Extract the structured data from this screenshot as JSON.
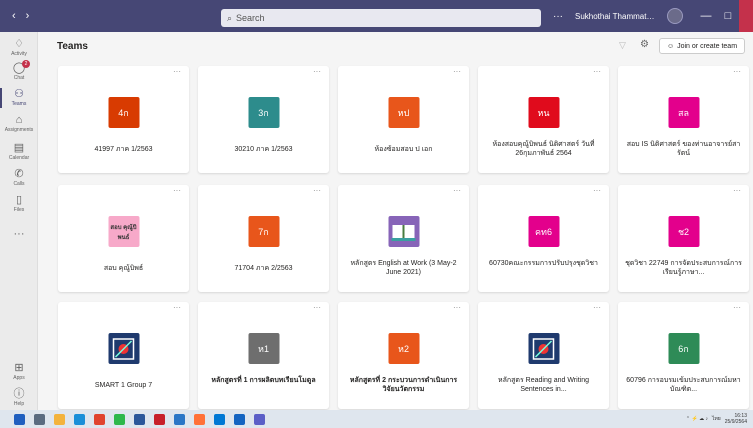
{
  "titlebar": {
    "back_icon": "chevron-left-icon",
    "forward_icon": "chevron-right-icon",
    "search_placeholder": "Search",
    "more_label": "···",
    "user_name": "Sukhothai Thammathirat Open ...",
    "minimize": "—",
    "maximize": "□"
  },
  "rail": {
    "items": [
      {
        "label": "Activity",
        "icon": "bell-icon"
      },
      {
        "label": "Chat",
        "icon": "chat-icon",
        "badge": "2"
      },
      {
        "label": "Teams",
        "icon": "teams-icon",
        "active": true
      },
      {
        "label": "Assignments",
        "icon": "assignments-icon"
      },
      {
        "label": "Calendar",
        "icon": "calendar-icon"
      },
      {
        "label": "Calls",
        "icon": "phone-icon"
      },
      {
        "label": "Files",
        "icon": "file-icon"
      },
      {
        "label": "···",
        "icon": "more-icon"
      },
      {
        "label": "Apps",
        "icon": "apps-icon"
      },
      {
        "label": "Help",
        "icon": "help-icon"
      }
    ]
  },
  "header": {
    "title": "Teams",
    "join_label": "Join or create team"
  },
  "teams": [
    {
      "tile": "4ก",
      "color": "#d83b01",
      "name": "41997 ภาค 1/2563"
    },
    {
      "tile": "3ก",
      "color": "#2d8c8c",
      "name": "30210 ภาค 1/2563"
    },
    {
      "tile": "หป",
      "color": "#e8561b",
      "name": "ห้องซ้อมสอบ ป เอก"
    },
    {
      "tile": "หน",
      "color": "#e00b1c",
      "name": "ห้องสอบคุณู้บิพนธ์ นิติศาสตร์ วันที่ 26กุมภาพันธ์ 2564"
    },
    {
      "tile": "สล",
      "color": "#e3008c",
      "name": "สอบ IS นิติศาสตร์ ของท่านอาจารย์สารัตน์"
    },
    {
      "tile": "สอบ คุณู้บิพนธ์",
      "color": "#f7a9c9",
      "text_color": "#333333",
      "name": "สอบ คุณู้บิพธ์"
    },
    {
      "tile": "7ก",
      "color": "#e8561b",
      "name": "71704 ภาค 2/2563"
    },
    {
      "tile": "",
      "color": "#8764b8",
      "tile_icon": "book-icon",
      "name": "หลักสูตร English at Work (3 May-2 June 2021)"
    },
    {
      "tile": "คท6",
      "color": "#e3008c",
      "name": "60730คณะกรรมการปรับปรุงชุดวิชา"
    },
    {
      "tile": "ช2",
      "color": "#e3008c",
      "name": "ชุดวิชา 22749 การจัดประสบการณ์การเรียนรู้ภาษา..."
    },
    {
      "tile": "",
      "color": "#1f3a6e",
      "tile_icon": "smart-logo-icon",
      "name": "SMART 1 Group 7"
    },
    {
      "tile": "ห1",
      "color": "#6e6e6e",
      "name": "หลักสูตรที่ 1 การผลิตบทเรียนโมดูล",
      "bold": true
    },
    {
      "tile": "ห2",
      "color": "#e8561b",
      "name": "หลักสูตรที่ 2 กระบวนการดำเนินการวิจัยนวัตกรรม",
      "bold": true
    },
    {
      "tile": "",
      "color": "#1f3a6e",
      "tile_icon": "smart-logo-icon",
      "name": "หลักสูตร Reading and Writing Sentences in..."
    },
    {
      "tile": "6ก",
      "color": "#2e8b57",
      "name": "60796 การอบรมเข้มประสบการณ์มหาบัณฑิต..."
    }
  ],
  "taskbar": {
    "icons": [
      {
        "name": "windows-start-icon",
        "color": "#1f5fbf"
      },
      {
        "name": "search-taskbar-icon",
        "color": "#5a6b80"
      },
      {
        "name": "file-explorer-icon",
        "color": "#f3b33d"
      },
      {
        "name": "edge-icon",
        "color": "#1a8fd8"
      },
      {
        "name": "chrome-icon",
        "color": "#e0442f"
      },
      {
        "name": "line-icon",
        "color": "#2db84b"
      },
      {
        "name": "word-icon",
        "color": "#2b579a"
      },
      {
        "name": "filezilla-icon",
        "color": "#c7202a"
      },
      {
        "name": "unknown-app-icon",
        "color": "#2a76c6"
      },
      {
        "name": "firefox-icon",
        "color": "#ff7139"
      },
      {
        "name": "store-icon",
        "color": "#0078d4"
      },
      {
        "name": "outlook-icon",
        "color": "#1464c1"
      },
      {
        "name": "teams-taskbar-icon",
        "color": "#5b5fc7"
      }
    ],
    "lang": "ไทย",
    "time": "16:13",
    "date": "25/9/2564"
  }
}
